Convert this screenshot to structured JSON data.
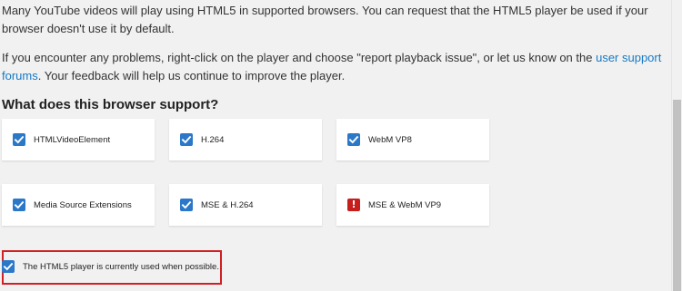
{
  "intro": {
    "paragraph1": "Many YouTube videos will play using HTML5 in supported browsers. You can request that the HTML5 player be used if your browser doesn't use it by default.",
    "paragraph2_before": "If you encounter any problems, right-click on the player and choose \"report playback issue\", or let us know on the ",
    "paragraph2_link": "user support forums",
    "paragraph2_after": ". Your feedback will help us continue to improve the player."
  },
  "heading": "What does this browser support?",
  "features": [
    {
      "label": "HTMLVideoElement",
      "supported": true,
      "icon": "checkmark-icon"
    },
    {
      "label": "H.264",
      "supported": true,
      "icon": "checkmark-icon"
    },
    {
      "label": "WebM VP8",
      "supported": true,
      "icon": "checkmark-icon"
    },
    {
      "label": "Media Source Extensions",
      "supported": true,
      "icon": "checkmark-icon"
    },
    {
      "label": "MSE & H.264",
      "supported": true,
      "icon": "checkmark-icon"
    },
    {
      "label": "MSE & WebM VP9",
      "supported": false,
      "icon": "exclamation-icon"
    }
  ],
  "status": {
    "label": "The HTML5 player is currently used when possible.",
    "icon": "checkmark-icon"
  },
  "colors": {
    "check_blue": "#2b78c9",
    "warning_red": "#c61d1d",
    "link_blue": "#167ac6",
    "highlight_red": "#d11f24"
  }
}
